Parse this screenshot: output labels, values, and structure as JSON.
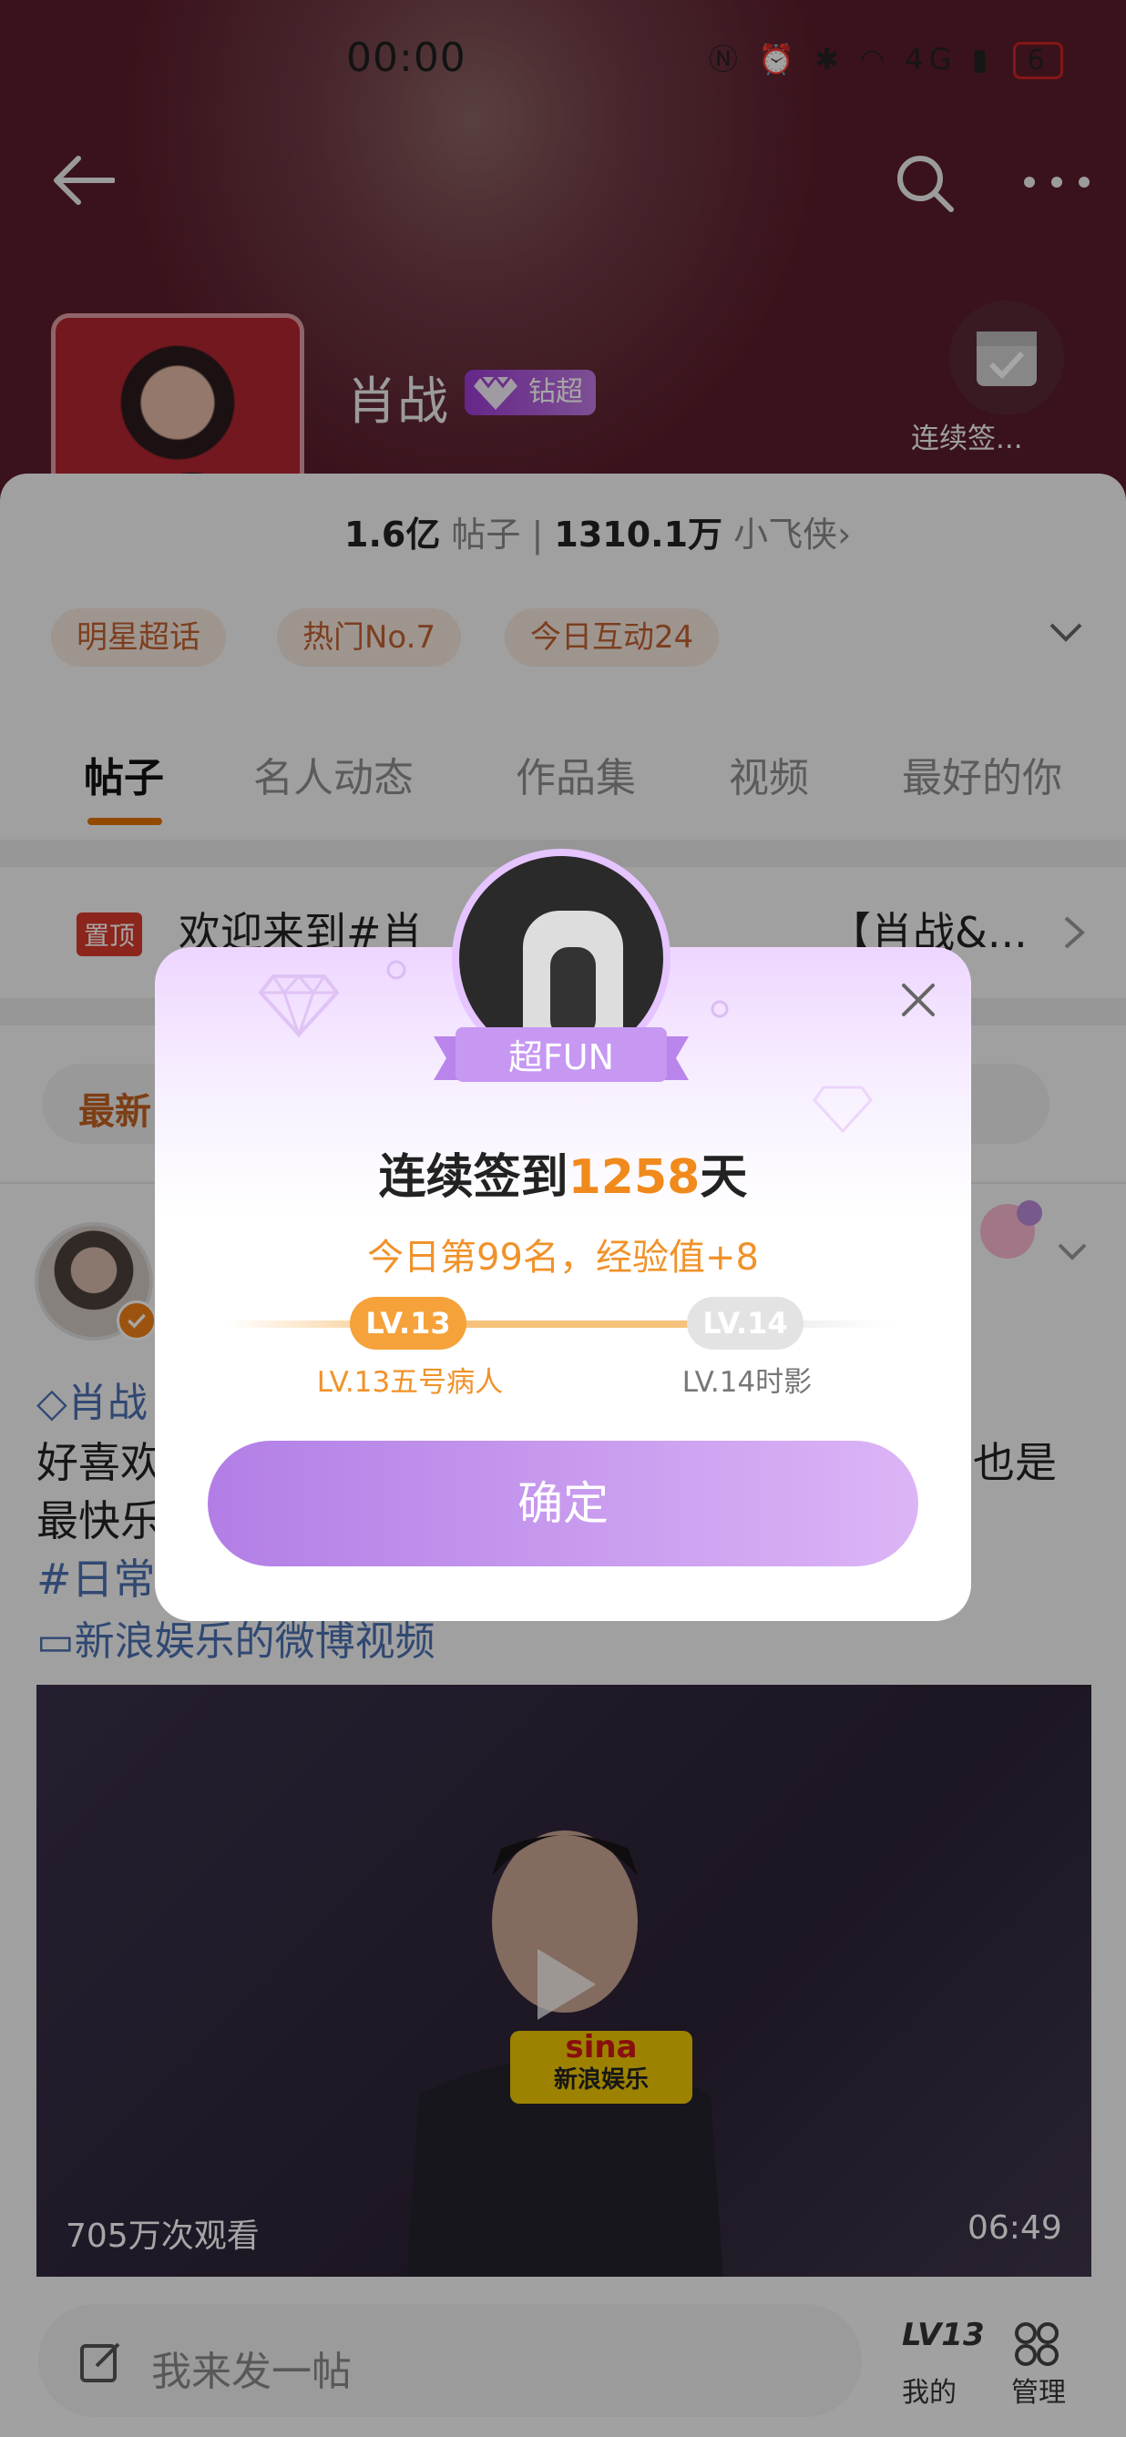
{
  "status_bar": {
    "time": "00:00",
    "network": "4G",
    "battery": "6"
  },
  "header": {
    "topic_name": "肖战",
    "tier_badge_text": "钻超",
    "checkin_label": "连续签..."
  },
  "stats": {
    "posts_count": "1.6亿",
    "posts_label": "帖子",
    "fans_count": "1310.1万",
    "fans_label": "小飞侠",
    "chevron": "›"
  },
  "tags": [
    "明星超话",
    "热门No.7",
    "今日互动24"
  ],
  "tabs": [
    "帖子",
    "名人动态",
    "作品集",
    "视频",
    "最好的你"
  ],
  "pinned": {
    "badge": "置顶",
    "text": "欢迎来到#肖",
    "text2": "【肖战&..."
  },
  "sort": {
    "label": "最新"
  },
  "post": {
    "topic": "肖战",
    "line1": "好喜欢",
    "line1_end": "也是",
    "line2": "最快乐",
    "hashtag": "#日常",
    "video_link": "新浪娱乐的微博视频"
  },
  "video": {
    "views": "705万次观看",
    "duration": "06:49",
    "mic_brand": "sina",
    "mic_sub": "新浪娱乐"
  },
  "bottom": {
    "compose_placeholder": "我来发一帖",
    "my_level": "LV13",
    "my_label": "我的",
    "manage_label": "管理"
  },
  "modal": {
    "ribbon": "超FUN",
    "title_prefix": "连续签到",
    "days": "1258",
    "title_suffix": "天",
    "subtitle": "今日第99名，经验值+8",
    "current_level": "LV.13",
    "current_level_name": "LV.13五号病人",
    "next_level": "LV.14",
    "next_level_name": "LV.14时影",
    "confirm": "确定"
  },
  "colors": {
    "accent": "#f08a1c",
    "modal_button": "#b27ee6",
    "link": "#4a6fb0"
  }
}
